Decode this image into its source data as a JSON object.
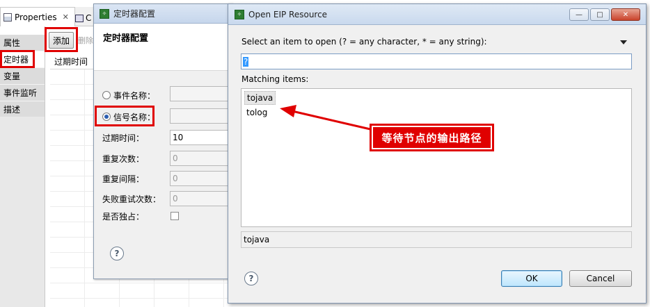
{
  "properties_view": {
    "tab_label": "Properties",
    "tab_close": "✕",
    "tab2_fragment": "C",
    "side_tabs": [
      {
        "label": "属性"
      },
      {
        "label": "定时器"
      },
      {
        "label": "变量"
      },
      {
        "label": "事件监听"
      },
      {
        "label": "描述"
      }
    ],
    "add_button": "添加",
    "delete_fragment": "删除",
    "column_header": "过期时间"
  },
  "timer_window": {
    "title": "定时器配置",
    "heading": "定时器配置",
    "event_name_label": "事件名称：",
    "signal_name_label": "信号名称：",
    "expire_label": "过期时间：",
    "expire_value": "10",
    "repeat_count_label": "重复次数：",
    "repeat_count_value": "0",
    "repeat_interval_label": "重复间隔：",
    "repeat_interval_value": "0",
    "retry_label": "失败重试次数：",
    "retry_value": "0",
    "exclusive_label": "是否独占："
  },
  "eip_dialog": {
    "title": "Open EIP Resource",
    "prompt_prefix": "Select an item to open (? = any character, * = any string):",
    "search_value": "?",
    "matching_label": "Matching items:",
    "items": [
      {
        "label": "tojava"
      },
      {
        "label": "tolog"
      }
    ],
    "status_value": "tojava",
    "ok_label": "OK",
    "cancel_label": "Cancel",
    "min_glyph": "—",
    "max_glyph": "□",
    "close_glyph": "✕"
  },
  "annotation": {
    "text": "等待节点的输出路径"
  },
  "colors": {
    "annotation_red": "#e00000",
    "selection_blue": "#3399ff"
  }
}
